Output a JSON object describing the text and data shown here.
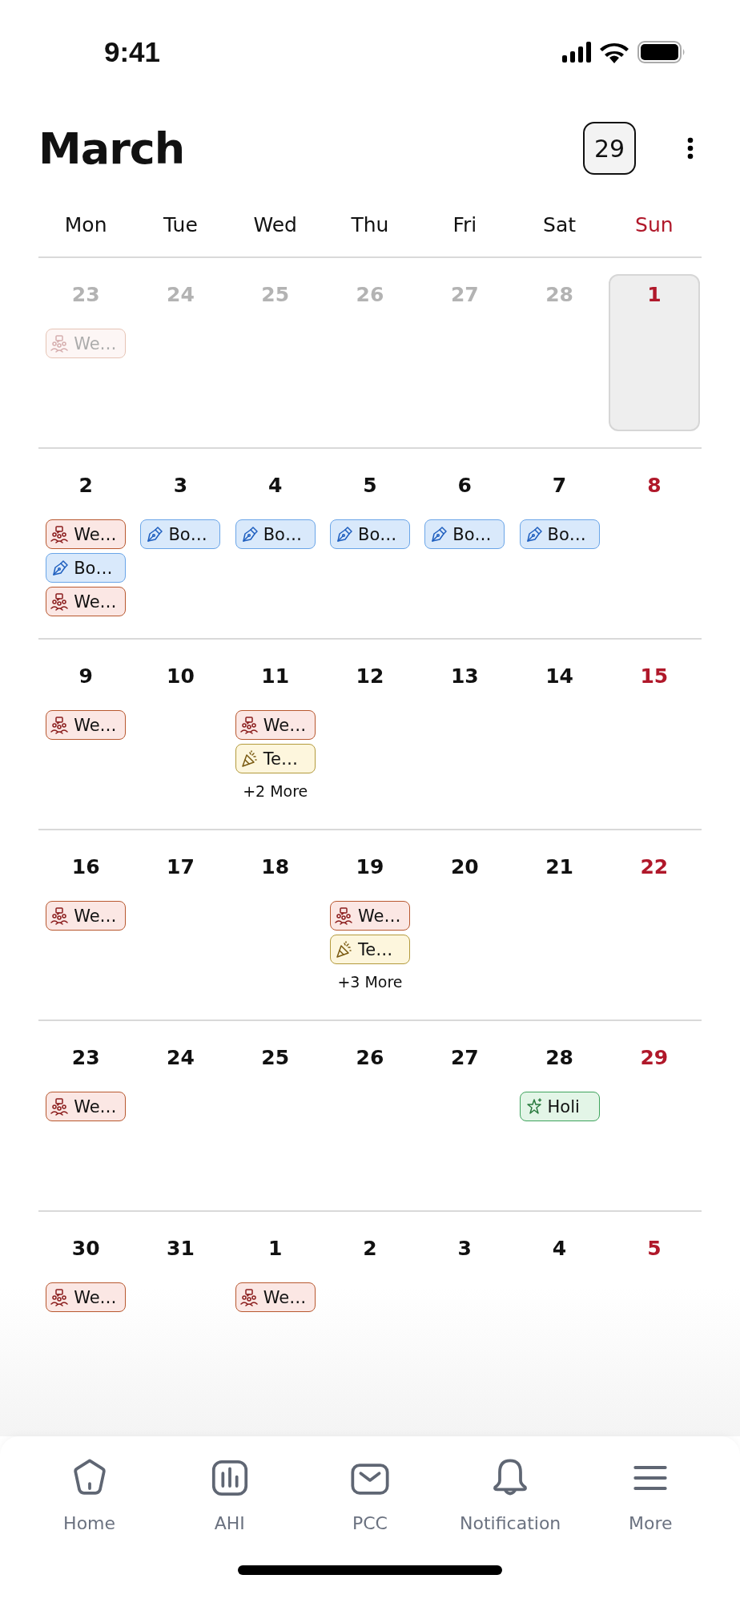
{
  "status_bar": {
    "time": "9:41"
  },
  "header": {
    "title": "March",
    "today_button": "29"
  },
  "weekdays": [
    {
      "label": "Mon",
      "weekend": false
    },
    {
      "label": "Tue",
      "weekend": false
    },
    {
      "label": "Wed",
      "weekend": false
    },
    {
      "label": "Thu",
      "weekend": false
    },
    {
      "label": "Fri",
      "weekend": false
    },
    {
      "label": "Sat",
      "weekend": false
    },
    {
      "label": "Sun",
      "weekend": true
    }
  ],
  "weeks": [
    {
      "days": [
        {
          "date": "23",
          "muted": true,
          "selected": false,
          "events": [
            {
              "kind": "meeting",
              "label": "We…"
            }
          ]
        },
        {
          "date": "24",
          "muted": true,
          "selected": false
        },
        {
          "date": "25",
          "muted": true,
          "selected": false
        },
        {
          "date": "26",
          "muted": true,
          "selected": false
        },
        {
          "date": "27",
          "muted": true,
          "selected": false
        },
        {
          "date": "28",
          "muted": true,
          "selected": false
        },
        {
          "date": "1",
          "muted": false,
          "selected": true
        }
      ]
    },
    {
      "days": [
        {
          "date": "2",
          "muted": false,
          "selected": false,
          "events": [
            {
              "kind": "meeting",
              "label": "We…"
            },
            {
              "kind": "pen",
              "label": "Bo…"
            },
            {
              "kind": "meeting",
              "label": "We…"
            }
          ]
        },
        {
          "date": "3",
          "muted": false,
          "selected": false,
          "events": [
            {
              "kind": "pen",
              "label": "Bo…"
            }
          ]
        },
        {
          "date": "4",
          "muted": false,
          "selected": false,
          "events": [
            {
              "kind": "pen",
              "label": "Bo…"
            }
          ]
        },
        {
          "date": "5",
          "muted": false,
          "selected": false,
          "events": [
            {
              "kind": "pen",
              "label": "Bo…"
            }
          ]
        },
        {
          "date": "6",
          "muted": false,
          "selected": false,
          "events": [
            {
              "kind": "pen",
              "label": "Bo…"
            }
          ]
        },
        {
          "date": "7",
          "muted": false,
          "selected": false,
          "events": [
            {
              "kind": "pen",
              "label": "Bo…"
            }
          ]
        },
        {
          "date": "8",
          "muted": false,
          "selected": false
        }
      ]
    },
    {
      "days": [
        {
          "date": "9",
          "muted": false,
          "selected": false,
          "events": [
            {
              "kind": "meeting",
              "label": "We…"
            }
          ]
        },
        {
          "date": "10",
          "muted": false,
          "selected": false
        },
        {
          "date": "11",
          "muted": false,
          "selected": false,
          "events": [
            {
              "kind": "meeting",
              "label": "We…"
            },
            {
              "kind": "party",
              "label": "Te…"
            }
          ],
          "more": "+2 More"
        },
        {
          "date": "12",
          "muted": false,
          "selected": false
        },
        {
          "date": "13",
          "muted": false,
          "selected": false
        },
        {
          "date": "14",
          "muted": false,
          "selected": false
        },
        {
          "date": "15",
          "muted": false,
          "selected": false
        }
      ]
    },
    {
      "days": [
        {
          "date": "16",
          "muted": false,
          "selected": false,
          "events": [
            {
              "kind": "meeting",
              "label": "We…"
            }
          ]
        },
        {
          "date": "17",
          "muted": false,
          "selected": false
        },
        {
          "date": "18",
          "muted": false,
          "selected": false
        },
        {
          "date": "19",
          "muted": false,
          "selected": false,
          "events": [
            {
              "kind": "meeting",
              "label": "We…"
            },
            {
              "kind": "party",
              "label": "Te…"
            }
          ],
          "more": "+3 More"
        },
        {
          "date": "20",
          "muted": false,
          "selected": false
        },
        {
          "date": "21",
          "muted": false,
          "selected": false
        },
        {
          "date": "22",
          "muted": false,
          "selected": false
        }
      ]
    },
    {
      "days": [
        {
          "date": "23",
          "muted": false,
          "selected": false,
          "events": [
            {
              "kind": "meeting",
              "label": "We…"
            }
          ]
        },
        {
          "date": "24",
          "muted": false,
          "selected": false
        },
        {
          "date": "25",
          "muted": false,
          "selected": false
        },
        {
          "date": "26",
          "muted": false,
          "selected": false
        },
        {
          "date": "27",
          "muted": false,
          "selected": false
        },
        {
          "date": "28",
          "muted": false,
          "selected": false,
          "events": [
            {
              "kind": "holiday",
              "label": "Holi"
            }
          ]
        },
        {
          "date": "29",
          "muted": false,
          "selected": false
        }
      ]
    },
    {
      "days": [
        {
          "date": "30",
          "muted": false,
          "selected": false,
          "events": [
            {
              "kind": "meeting",
              "label": "We…"
            }
          ]
        },
        {
          "date": "31",
          "muted": false,
          "selected": false
        },
        {
          "date": "1",
          "muted": false,
          "selected": false,
          "events": [
            {
              "kind": "meeting",
              "label": "We…"
            }
          ]
        },
        {
          "date": "2",
          "muted": false,
          "selected": false
        },
        {
          "date": "3",
          "muted": false,
          "selected": false
        },
        {
          "date": "4",
          "muted": false,
          "selected": false
        },
        {
          "date": "5",
          "muted": false,
          "selected": false
        }
      ]
    }
  ],
  "nav": [
    {
      "kind": "home",
      "label": "Home"
    },
    {
      "kind": "chart",
      "label": "AHI"
    },
    {
      "kind": "mail",
      "label": "PCC"
    },
    {
      "kind": "bell",
      "label": "Notification"
    },
    {
      "kind": "menu",
      "label": "More"
    }
  ]
}
